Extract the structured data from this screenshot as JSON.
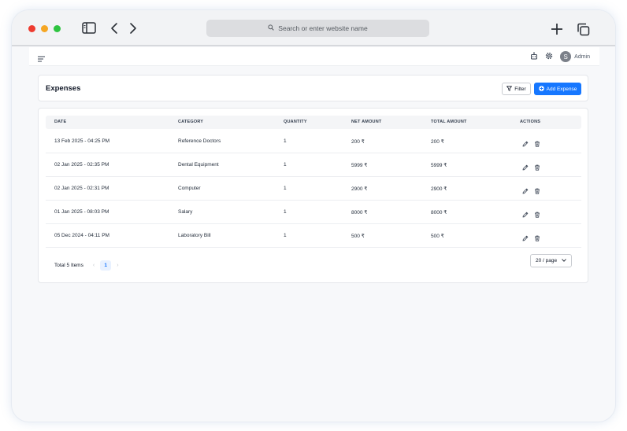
{
  "browser": {
    "search_placeholder": "Search or enter website name"
  },
  "topbar": {
    "user_initial": "S",
    "user_name": "Admin"
  },
  "page": {
    "title": "Expenses",
    "filter_label": "Filter",
    "add_label": "Add Expense"
  },
  "table": {
    "columns": [
      "DATE",
      "CATEGORY",
      "QUANTITY",
      "NET AMOUNT",
      "TOTAL AMOUNT",
      "ACTIONS"
    ],
    "rows": [
      {
        "date": "13 Feb 2025 - 04:25 PM",
        "category": "Reference Doctors",
        "quantity": "1",
        "net": "200 ₹",
        "total": "200 ₹"
      },
      {
        "date": "02 Jan 2025 - 02:35 PM",
        "category": "Dental Equipment",
        "quantity": "1",
        "net": "5999 ₹",
        "total": "5999 ₹"
      },
      {
        "date": "02 Jan 2025 - 02:31 PM",
        "category": "Computer",
        "quantity": "1",
        "net": "2900 ₹",
        "total": "2900 ₹"
      },
      {
        "date": "01 Jan 2025 - 08:03 PM",
        "category": "Salary",
        "quantity": "1",
        "net": "8000 ₹",
        "total": "8000 ₹"
      },
      {
        "date": "05 Dec 2024 - 04:11 PM",
        "category": "Laboratory Bill",
        "quantity": "1",
        "net": "500 ₹",
        "total": "500 ₹"
      }
    ]
  },
  "pagination": {
    "total_label": "Total 5 Items",
    "current_page": "1",
    "page_size": "20 / page"
  },
  "colors": {
    "accent": "#1677ff",
    "traffic_red": "#ee3b2f",
    "traffic_yellow": "#f5a623",
    "traffic_green": "#2ec440"
  }
}
